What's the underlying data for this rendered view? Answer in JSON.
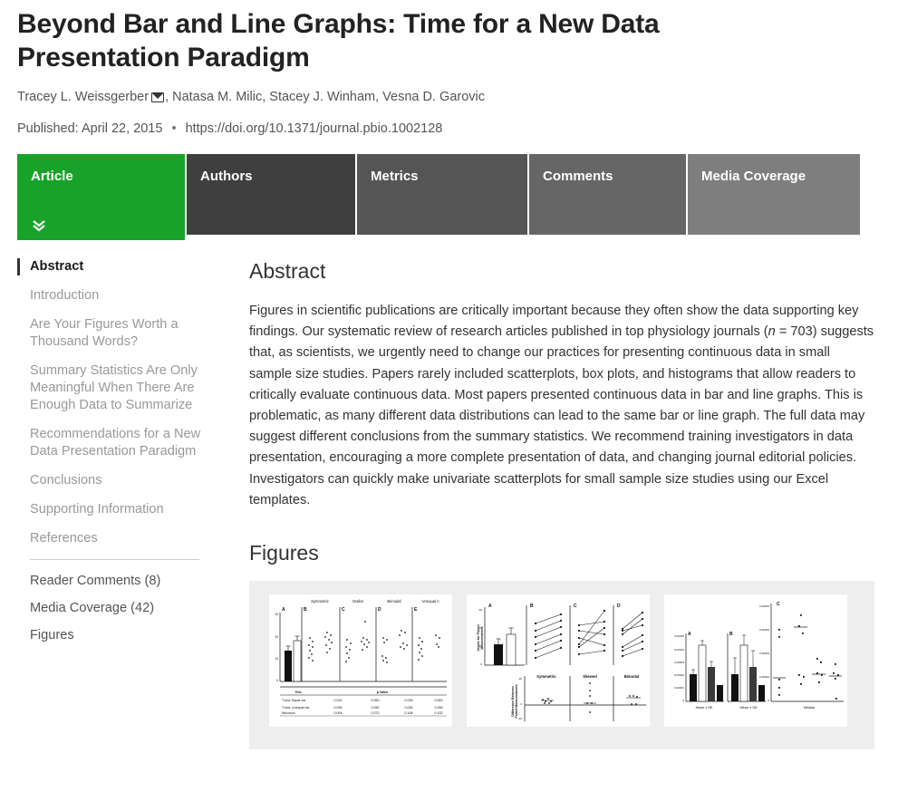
{
  "article": {
    "title": "Beyond Bar and Line Graphs: Time for a New Data Presentation Paradigm",
    "authors_prefix": "Tracey L. Weissgerber",
    "authors_rest": ", Natasa M. Milic,  Stacey J. Winham,  Vesna D. Garovic",
    "email_icon": "envelope-icon",
    "published_label": "Published: April 22, 2015",
    "separator": "•",
    "doi": "https://doi.org/10.1371/journal.pbio.1002128"
  },
  "tabs": [
    {
      "label": "Article",
      "active": true,
      "color": "#19a229"
    },
    {
      "label": "Authors",
      "active": false,
      "color": "#3f3f3f"
    },
    {
      "label": "Metrics",
      "active": false,
      "color": "#555555"
    },
    {
      "label": "Comments",
      "active": false,
      "color": "#666666"
    },
    {
      "label": "Media Coverage",
      "active": false,
      "color": "#7e7e7e"
    }
  ],
  "sidebar": {
    "toc": [
      {
        "label": "Abstract",
        "active": true
      },
      {
        "label": "Introduction",
        "active": false
      },
      {
        "label": "Are Your Figures Worth a Thousand Words?",
        "active": false
      },
      {
        "label": "Summary Statistics Are Only Meaningful When There Are Enough Data to Summarize",
        "active": false
      },
      {
        "label": "Recommendations for a New Data Presentation Paradigm",
        "active": false
      },
      {
        "label": "Conclusions",
        "active": false
      },
      {
        "label": "Supporting Information",
        "active": false
      },
      {
        "label": "References",
        "active": false
      }
    ],
    "links": [
      {
        "label": "Reader Comments (8)"
      },
      {
        "label": "Media Coverage (42)"
      },
      {
        "label": "Figures"
      }
    ]
  },
  "main": {
    "abstract_heading": "Abstract",
    "abstract_text_1": "Figures in scientific publications are critically important because they often show the data supporting key findings. Our systematic review of research articles published in top physiology journals (",
    "abstract_italic_n": "n",
    "abstract_text_2": " = 703) suggests that, as scientists, we urgently need to change our practices for presenting continuous data in small sample size studies. Papers rarely included scatterplots, box plots, and histograms that allow readers to critically evaluate continuous data. Most papers presented continuous data in bar and line graphs. This is problematic, as many different data distributions can lead to the same bar or line graph. The full data may suggest different conclusions from the summary statistics. We recommend training investigators in data presentation, encouraging a more complete presentation of data, and changing journal editorial policies. Investigators can quickly make univariate scatterplots for small sample size studies using our Excel templates.",
    "figures_heading": "Figures"
  },
  "figures": [
    {
      "name": "figure-1-thumbnail",
      "panels": [
        "A",
        "B",
        "C",
        "D",
        "E"
      ],
      "column_titles": [
        "Symmetric",
        "Outlier",
        "Bimodal",
        "Unequal n"
      ],
      "table": {
        "headers": [
          "Test",
          "p Value"
        ],
        "rows": [
          {
            "test": "T-test: Equal var.",
            "values": [
              "0.031",
              "0.060",
              "0.026",
              "0.063"
            ]
          },
          {
            "test": "T-test: Unequal var.",
            "values": [
              "0.035",
              "0.050",
              "0.026",
              "0.055"
            ]
          },
          {
            "test": "Wilcoxon",
            "values": [
              "0.004",
              "0.073",
              "0.108",
              "0.102"
            ]
          }
        ]
      }
    },
    {
      "name": "figure-2-thumbnail",
      "panels": [
        "A",
        "B",
        "C",
        "D"
      ],
      "ylabel_top": "Values for Paired Measurements",
      "ylabel_bottom": "Difference Between Paired Measurements",
      "column_titles": [
        "Symmetric",
        "Skewed",
        "Bimodal"
      ]
    },
    {
      "name": "figure-3-thumbnail",
      "panels": [
        "A",
        "B",
        "C"
      ],
      "xlabels": [
        "Mean ± SE",
        "Mean ± SD",
        "Median"
      ],
      "yticks": [
        "0.00005",
        "0.00004",
        "0.00003",
        "0.00002",
        "0.00001",
        "0"
      ]
    }
  ]
}
